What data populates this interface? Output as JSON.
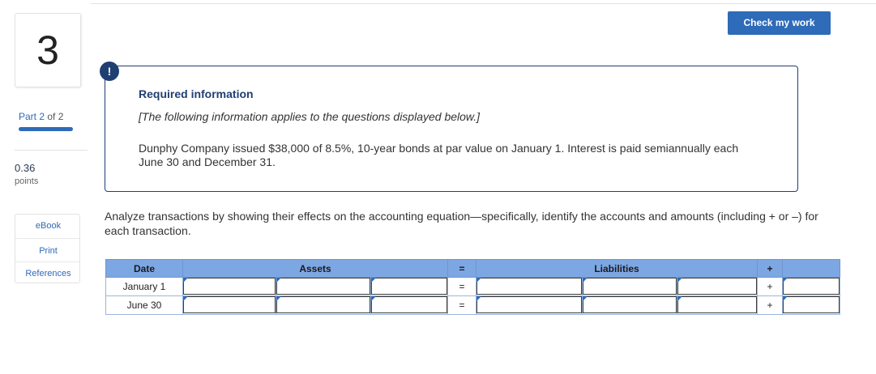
{
  "question": {
    "number": "3"
  },
  "part": {
    "current": "Part 2",
    "of_total": "of 2",
    "progress": 1.0
  },
  "points": {
    "value": "0.36",
    "label": "points"
  },
  "resources": [
    "eBook",
    "Print",
    "References"
  ],
  "toolbar": {
    "check_label": "Check my work"
  },
  "alert": {
    "icon": "!"
  },
  "required": {
    "title": "Required information",
    "note": "[The following information applies to the questions displayed below.]",
    "body": "Dunphy Company issued $38,000 of 8.5%, 10-year bonds at par value on January 1. Interest is paid semiannually each June 30 and December 31."
  },
  "instructions": "Analyze transactions by showing their effects on the accounting equation—specifically, identify the accounts and amounts (including + or –) for each transaction.",
  "table": {
    "headers": {
      "date": "Date",
      "assets": "Assets",
      "eq": "=",
      "liabilities": "Liabilities",
      "plus": "+"
    },
    "rows": [
      {
        "date": "January 1",
        "eq": "=",
        "plus": "+"
      },
      {
        "date": "June 30",
        "eq": "=",
        "plus": "+"
      }
    ]
  },
  "colors": {
    "accent": "#2e6bb8",
    "navy": "#1f3f73",
    "header_bg": "#7da7e3"
  }
}
